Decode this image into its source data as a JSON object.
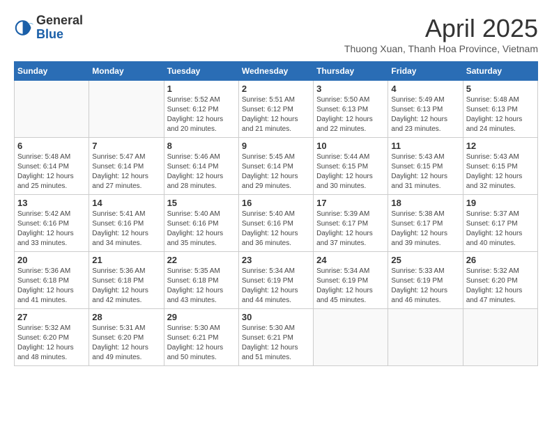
{
  "header": {
    "logo_general": "General",
    "logo_blue": "Blue",
    "month_title": "April 2025",
    "location": "Thuong Xuan, Thanh Hoa Province, Vietnam"
  },
  "days_of_week": [
    "Sunday",
    "Monday",
    "Tuesday",
    "Wednesday",
    "Thursday",
    "Friday",
    "Saturday"
  ],
  "weeks": [
    [
      {
        "day": "",
        "info": ""
      },
      {
        "day": "",
        "info": ""
      },
      {
        "day": "1",
        "info": "Sunrise: 5:52 AM\nSunset: 6:12 PM\nDaylight: 12 hours and 20 minutes."
      },
      {
        "day": "2",
        "info": "Sunrise: 5:51 AM\nSunset: 6:12 PM\nDaylight: 12 hours and 21 minutes."
      },
      {
        "day": "3",
        "info": "Sunrise: 5:50 AM\nSunset: 6:13 PM\nDaylight: 12 hours and 22 minutes."
      },
      {
        "day": "4",
        "info": "Sunrise: 5:49 AM\nSunset: 6:13 PM\nDaylight: 12 hours and 23 minutes."
      },
      {
        "day": "5",
        "info": "Sunrise: 5:48 AM\nSunset: 6:13 PM\nDaylight: 12 hours and 24 minutes."
      }
    ],
    [
      {
        "day": "6",
        "info": "Sunrise: 5:48 AM\nSunset: 6:14 PM\nDaylight: 12 hours and 25 minutes."
      },
      {
        "day": "7",
        "info": "Sunrise: 5:47 AM\nSunset: 6:14 PM\nDaylight: 12 hours and 27 minutes."
      },
      {
        "day": "8",
        "info": "Sunrise: 5:46 AM\nSunset: 6:14 PM\nDaylight: 12 hours and 28 minutes."
      },
      {
        "day": "9",
        "info": "Sunrise: 5:45 AM\nSunset: 6:14 PM\nDaylight: 12 hours and 29 minutes."
      },
      {
        "day": "10",
        "info": "Sunrise: 5:44 AM\nSunset: 6:15 PM\nDaylight: 12 hours and 30 minutes."
      },
      {
        "day": "11",
        "info": "Sunrise: 5:43 AM\nSunset: 6:15 PM\nDaylight: 12 hours and 31 minutes."
      },
      {
        "day": "12",
        "info": "Sunrise: 5:43 AM\nSunset: 6:15 PM\nDaylight: 12 hours and 32 minutes."
      }
    ],
    [
      {
        "day": "13",
        "info": "Sunrise: 5:42 AM\nSunset: 6:16 PM\nDaylight: 12 hours and 33 minutes."
      },
      {
        "day": "14",
        "info": "Sunrise: 5:41 AM\nSunset: 6:16 PM\nDaylight: 12 hours and 34 minutes."
      },
      {
        "day": "15",
        "info": "Sunrise: 5:40 AM\nSunset: 6:16 PM\nDaylight: 12 hours and 35 minutes."
      },
      {
        "day": "16",
        "info": "Sunrise: 5:40 AM\nSunset: 6:16 PM\nDaylight: 12 hours and 36 minutes."
      },
      {
        "day": "17",
        "info": "Sunrise: 5:39 AM\nSunset: 6:17 PM\nDaylight: 12 hours and 37 minutes."
      },
      {
        "day": "18",
        "info": "Sunrise: 5:38 AM\nSunset: 6:17 PM\nDaylight: 12 hours and 39 minutes."
      },
      {
        "day": "19",
        "info": "Sunrise: 5:37 AM\nSunset: 6:17 PM\nDaylight: 12 hours and 40 minutes."
      }
    ],
    [
      {
        "day": "20",
        "info": "Sunrise: 5:36 AM\nSunset: 6:18 PM\nDaylight: 12 hours and 41 minutes."
      },
      {
        "day": "21",
        "info": "Sunrise: 5:36 AM\nSunset: 6:18 PM\nDaylight: 12 hours and 42 minutes."
      },
      {
        "day": "22",
        "info": "Sunrise: 5:35 AM\nSunset: 6:18 PM\nDaylight: 12 hours and 43 minutes."
      },
      {
        "day": "23",
        "info": "Sunrise: 5:34 AM\nSunset: 6:19 PM\nDaylight: 12 hours and 44 minutes."
      },
      {
        "day": "24",
        "info": "Sunrise: 5:34 AM\nSunset: 6:19 PM\nDaylight: 12 hours and 45 minutes."
      },
      {
        "day": "25",
        "info": "Sunrise: 5:33 AM\nSunset: 6:19 PM\nDaylight: 12 hours and 46 minutes."
      },
      {
        "day": "26",
        "info": "Sunrise: 5:32 AM\nSunset: 6:20 PM\nDaylight: 12 hours and 47 minutes."
      }
    ],
    [
      {
        "day": "27",
        "info": "Sunrise: 5:32 AM\nSunset: 6:20 PM\nDaylight: 12 hours and 48 minutes."
      },
      {
        "day": "28",
        "info": "Sunrise: 5:31 AM\nSunset: 6:20 PM\nDaylight: 12 hours and 49 minutes."
      },
      {
        "day": "29",
        "info": "Sunrise: 5:30 AM\nSunset: 6:21 PM\nDaylight: 12 hours and 50 minutes."
      },
      {
        "day": "30",
        "info": "Sunrise: 5:30 AM\nSunset: 6:21 PM\nDaylight: 12 hours and 51 minutes."
      },
      {
        "day": "",
        "info": ""
      },
      {
        "day": "",
        "info": ""
      },
      {
        "day": "",
        "info": ""
      }
    ]
  ]
}
